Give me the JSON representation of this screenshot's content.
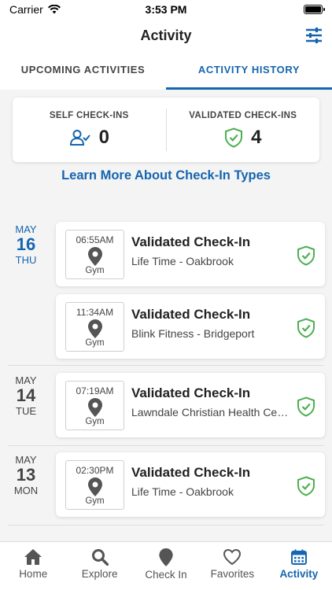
{
  "status": {
    "carrier": "Carrier",
    "time": "3:53 PM"
  },
  "header": {
    "title": "Activity"
  },
  "tabs": [
    {
      "label": "UPCOMING ACTIVITIES",
      "active": false
    },
    {
      "label": "ACTIVITY HISTORY",
      "active": true
    }
  ],
  "summary": {
    "self_label": "SELF CHECK-INS",
    "self_count": "0",
    "validated_label": "VALIDATED CHECK-INS",
    "validated_count": "4"
  },
  "learn_more": "Learn More About Check-In Types",
  "days": [
    {
      "month": "MAY",
      "day": "16",
      "weekday": "THU",
      "highlight": true,
      "checkins": [
        {
          "time": "06:55AM",
          "category": "Gym",
          "title": "Validated Check-In",
          "location": "Life Time - Oakbrook"
        },
        {
          "time": "11:34AM",
          "category": "Gym",
          "title": "Validated Check-In",
          "location": "Blink Fitness - Bridgeport"
        }
      ]
    },
    {
      "month": "MAY",
      "day": "14",
      "weekday": "TUE",
      "highlight": false,
      "checkins": [
        {
          "time": "07:19AM",
          "category": "Gym",
          "title": "Validated Check-In",
          "location": "Lawndale Christian Health Center"
        }
      ]
    },
    {
      "month": "MAY",
      "day": "13",
      "weekday": "MON",
      "highlight": false,
      "checkins": [
        {
          "time": "02:30PM",
          "category": "Gym",
          "title": "Validated Check-In",
          "location": "Life Time - Oakbrook"
        }
      ]
    }
  ],
  "nav": [
    {
      "label": "Home",
      "icon": "home-icon",
      "active": false
    },
    {
      "label": "Explore",
      "icon": "search-icon",
      "active": false
    },
    {
      "label": "Check In",
      "icon": "map-pin-icon",
      "active": false
    },
    {
      "label": "Favorites",
      "icon": "heart-icon",
      "active": false
    },
    {
      "label": "Activity",
      "icon": "calendar-icon",
      "active": true
    }
  ],
  "colors": {
    "accent": "#1565b0",
    "validated": "#4caf50"
  }
}
